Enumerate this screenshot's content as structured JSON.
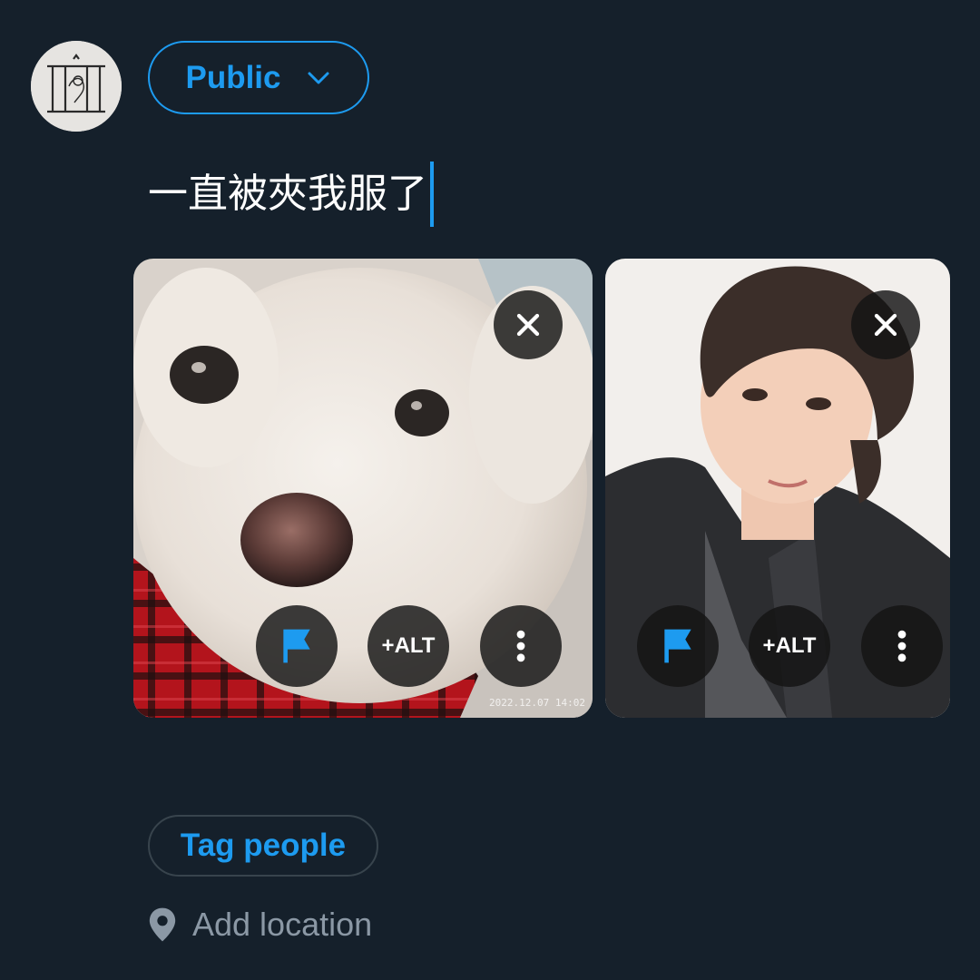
{
  "composer": {
    "audience_label": "Public",
    "text": "一直被夾我服了"
  },
  "media": [
    {
      "description": "white puppy photo",
      "timestamp": "2022.12.07 14:02",
      "alt_label": "+ALT"
    },
    {
      "description": "portrait photo",
      "alt_label": "+ALT"
    }
  ],
  "actions": {
    "tag_people_label": "Tag people",
    "add_location_label": "Add location"
  },
  "colors": {
    "background": "#15202b",
    "accent": "#1d9bf0",
    "muted": "#8b98a5",
    "border": "#38444d"
  },
  "icons": {
    "audience_chevron": "chevron-down-icon",
    "remove_media": "close-icon",
    "content_warning": "flag-icon",
    "more": "more-vertical-icon",
    "location": "location-pin-icon"
  }
}
